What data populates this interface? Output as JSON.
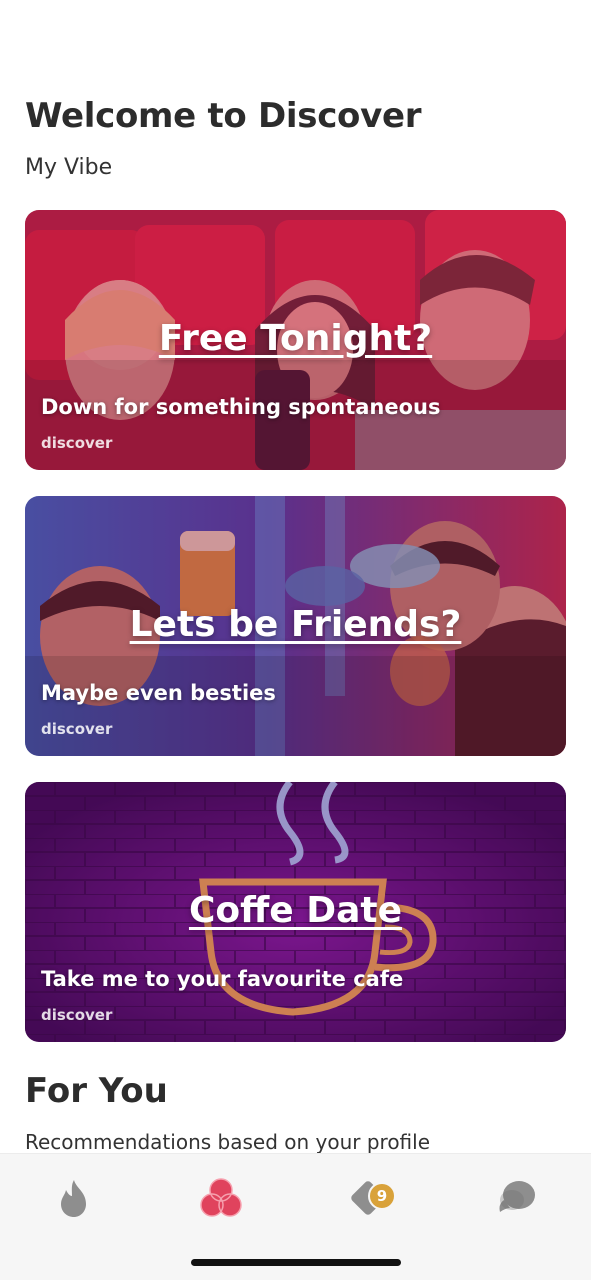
{
  "header": {
    "title": "Welcome to Discover",
    "subtitle": "My Vibe"
  },
  "cards": [
    {
      "title": "Free Tonight?",
      "description": "Down for something spontaneous",
      "tag": "discover",
      "overlay_color": "#c2185b"
    },
    {
      "title": "Lets be Friends?",
      "description": "Maybe even besties",
      "tag": "discover",
      "overlay_color": "#8e1a4c"
    },
    {
      "title": "Coffe Date",
      "description": "Take me to your favourite cafe",
      "tag": "discover",
      "overlay_color": "#5a0a6e"
    }
  ],
  "for_you": {
    "title": "For You",
    "subtitle": "Recommendations based on your profile"
  },
  "tabbar": {
    "items": [
      {
        "icon": "flame-icon",
        "active": false
      },
      {
        "icon": "discover-circles-icon",
        "active": true
      },
      {
        "icon": "diamond-likes-icon",
        "active": false,
        "badge": "9"
      },
      {
        "icon": "chat-bubbles-icon",
        "active": false
      }
    ],
    "active_color": "#e0435d",
    "inactive_color": "#8e8e8e",
    "badge_color": "#d9a23a"
  }
}
